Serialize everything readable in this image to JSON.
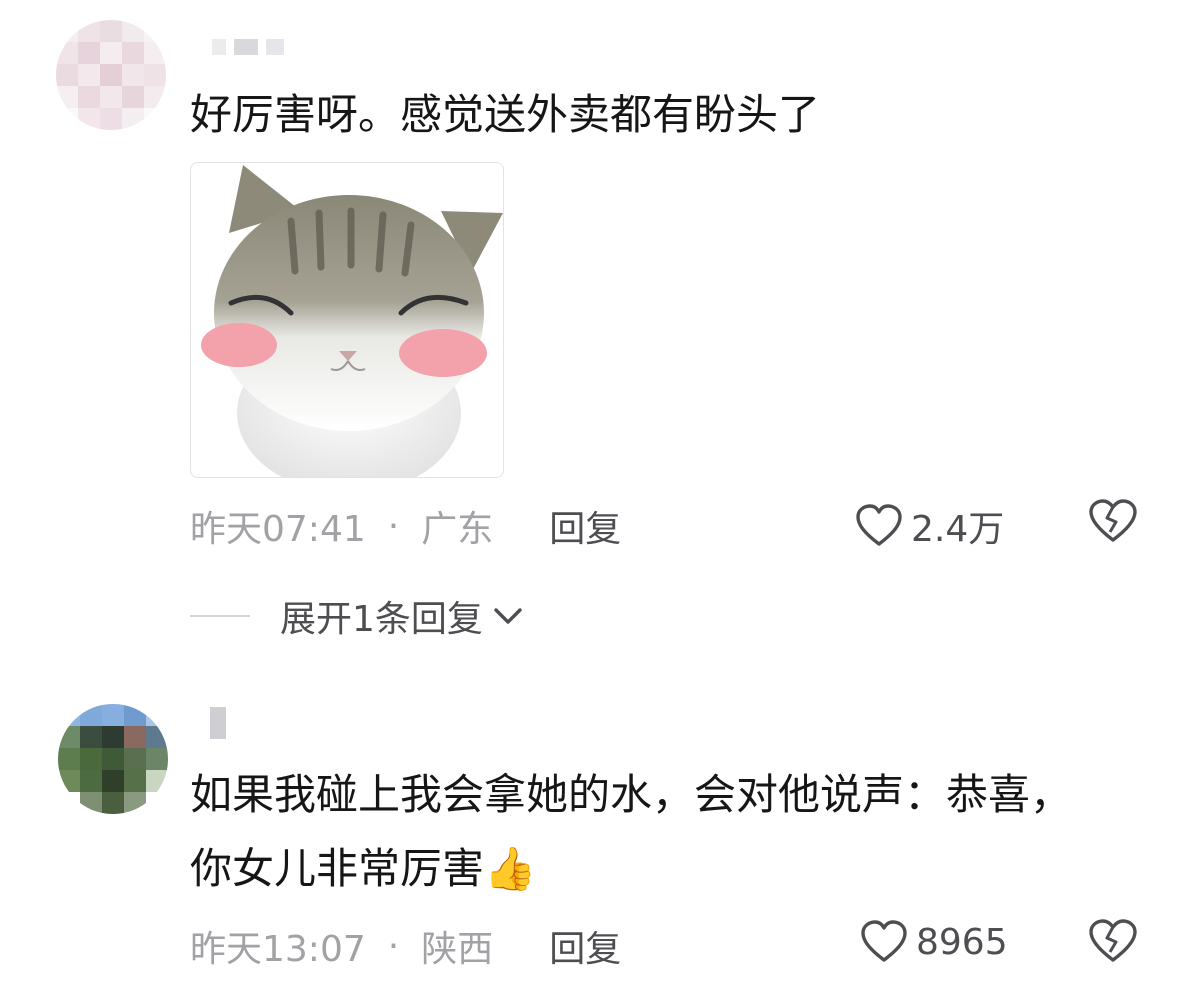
{
  "comments": [
    {
      "text": "好厉害呀。感觉送外卖都有盼头了",
      "sticker_name": "blushing-cat-sticker",
      "time": "昨天07:41",
      "separator": "·",
      "location": "广东",
      "reply_label": "回复",
      "likes": "2.4万",
      "expand_replies": "展开1条回复"
    },
    {
      "text_line1": "如果我碰上我会拿她的水，会对他说声：恭喜，",
      "text_line2": "你女儿非常厉害",
      "emoji": "👍",
      "time": "昨天13:07",
      "separator": "·",
      "location": "陕西",
      "reply_label": "回复",
      "likes": "8965"
    }
  ],
  "icons": {
    "like": "heart-outline-icon",
    "dislike": "broken-heart-icon",
    "expand": "chevron-down-icon"
  },
  "colors": {
    "text": "#161616",
    "meta": "#a2a2a6",
    "action": "#4e4e52",
    "blush": "#f3a1aa"
  }
}
